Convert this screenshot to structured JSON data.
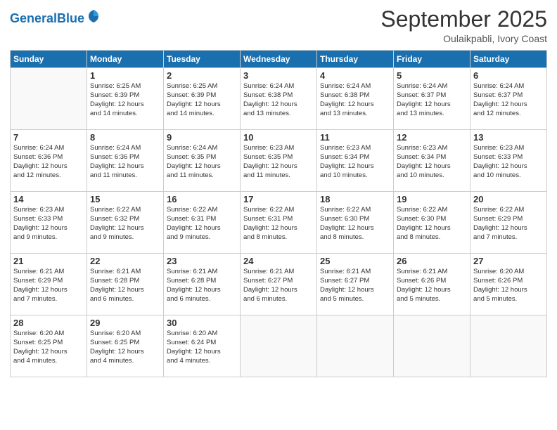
{
  "header": {
    "logo_line1": "General",
    "logo_line2": "Blue",
    "month": "September 2025",
    "location": "Oulaikpabli, Ivory Coast"
  },
  "weekdays": [
    "Sunday",
    "Monday",
    "Tuesday",
    "Wednesday",
    "Thursday",
    "Friday",
    "Saturday"
  ],
  "weeks": [
    [
      {
        "day": "",
        "info": ""
      },
      {
        "day": "1",
        "info": "Sunrise: 6:25 AM\nSunset: 6:39 PM\nDaylight: 12 hours\nand 14 minutes."
      },
      {
        "day": "2",
        "info": "Sunrise: 6:25 AM\nSunset: 6:39 PM\nDaylight: 12 hours\nand 14 minutes."
      },
      {
        "day": "3",
        "info": "Sunrise: 6:24 AM\nSunset: 6:38 PM\nDaylight: 12 hours\nand 13 minutes."
      },
      {
        "day": "4",
        "info": "Sunrise: 6:24 AM\nSunset: 6:38 PM\nDaylight: 12 hours\nand 13 minutes."
      },
      {
        "day": "5",
        "info": "Sunrise: 6:24 AM\nSunset: 6:37 PM\nDaylight: 12 hours\nand 13 minutes."
      },
      {
        "day": "6",
        "info": "Sunrise: 6:24 AM\nSunset: 6:37 PM\nDaylight: 12 hours\nand 12 minutes."
      }
    ],
    [
      {
        "day": "7",
        "info": "Sunrise: 6:24 AM\nSunset: 6:36 PM\nDaylight: 12 hours\nand 12 minutes."
      },
      {
        "day": "8",
        "info": "Sunrise: 6:24 AM\nSunset: 6:36 PM\nDaylight: 12 hours\nand 11 minutes."
      },
      {
        "day": "9",
        "info": "Sunrise: 6:24 AM\nSunset: 6:35 PM\nDaylight: 12 hours\nand 11 minutes."
      },
      {
        "day": "10",
        "info": "Sunrise: 6:23 AM\nSunset: 6:35 PM\nDaylight: 12 hours\nand 11 minutes."
      },
      {
        "day": "11",
        "info": "Sunrise: 6:23 AM\nSunset: 6:34 PM\nDaylight: 12 hours\nand 10 minutes."
      },
      {
        "day": "12",
        "info": "Sunrise: 6:23 AM\nSunset: 6:34 PM\nDaylight: 12 hours\nand 10 minutes."
      },
      {
        "day": "13",
        "info": "Sunrise: 6:23 AM\nSunset: 6:33 PM\nDaylight: 12 hours\nand 10 minutes."
      }
    ],
    [
      {
        "day": "14",
        "info": "Sunrise: 6:23 AM\nSunset: 6:33 PM\nDaylight: 12 hours\nand 9 minutes."
      },
      {
        "day": "15",
        "info": "Sunrise: 6:22 AM\nSunset: 6:32 PM\nDaylight: 12 hours\nand 9 minutes."
      },
      {
        "day": "16",
        "info": "Sunrise: 6:22 AM\nSunset: 6:31 PM\nDaylight: 12 hours\nand 9 minutes."
      },
      {
        "day": "17",
        "info": "Sunrise: 6:22 AM\nSunset: 6:31 PM\nDaylight: 12 hours\nand 8 minutes."
      },
      {
        "day": "18",
        "info": "Sunrise: 6:22 AM\nSunset: 6:30 PM\nDaylight: 12 hours\nand 8 minutes."
      },
      {
        "day": "19",
        "info": "Sunrise: 6:22 AM\nSunset: 6:30 PM\nDaylight: 12 hours\nand 8 minutes."
      },
      {
        "day": "20",
        "info": "Sunrise: 6:22 AM\nSunset: 6:29 PM\nDaylight: 12 hours\nand 7 minutes."
      }
    ],
    [
      {
        "day": "21",
        "info": "Sunrise: 6:21 AM\nSunset: 6:29 PM\nDaylight: 12 hours\nand 7 minutes."
      },
      {
        "day": "22",
        "info": "Sunrise: 6:21 AM\nSunset: 6:28 PM\nDaylight: 12 hours\nand 6 minutes."
      },
      {
        "day": "23",
        "info": "Sunrise: 6:21 AM\nSunset: 6:28 PM\nDaylight: 12 hours\nand 6 minutes."
      },
      {
        "day": "24",
        "info": "Sunrise: 6:21 AM\nSunset: 6:27 PM\nDaylight: 12 hours\nand 6 minutes."
      },
      {
        "day": "25",
        "info": "Sunrise: 6:21 AM\nSunset: 6:27 PM\nDaylight: 12 hours\nand 5 minutes."
      },
      {
        "day": "26",
        "info": "Sunrise: 6:21 AM\nSunset: 6:26 PM\nDaylight: 12 hours\nand 5 minutes."
      },
      {
        "day": "27",
        "info": "Sunrise: 6:20 AM\nSunset: 6:26 PM\nDaylight: 12 hours\nand 5 minutes."
      }
    ],
    [
      {
        "day": "28",
        "info": "Sunrise: 6:20 AM\nSunset: 6:25 PM\nDaylight: 12 hours\nand 4 minutes."
      },
      {
        "day": "29",
        "info": "Sunrise: 6:20 AM\nSunset: 6:25 PM\nDaylight: 12 hours\nand 4 minutes."
      },
      {
        "day": "30",
        "info": "Sunrise: 6:20 AM\nSunset: 6:24 PM\nDaylight: 12 hours\nand 4 minutes."
      },
      {
        "day": "",
        "info": ""
      },
      {
        "day": "",
        "info": ""
      },
      {
        "day": "",
        "info": ""
      },
      {
        "day": "",
        "info": ""
      }
    ]
  ]
}
